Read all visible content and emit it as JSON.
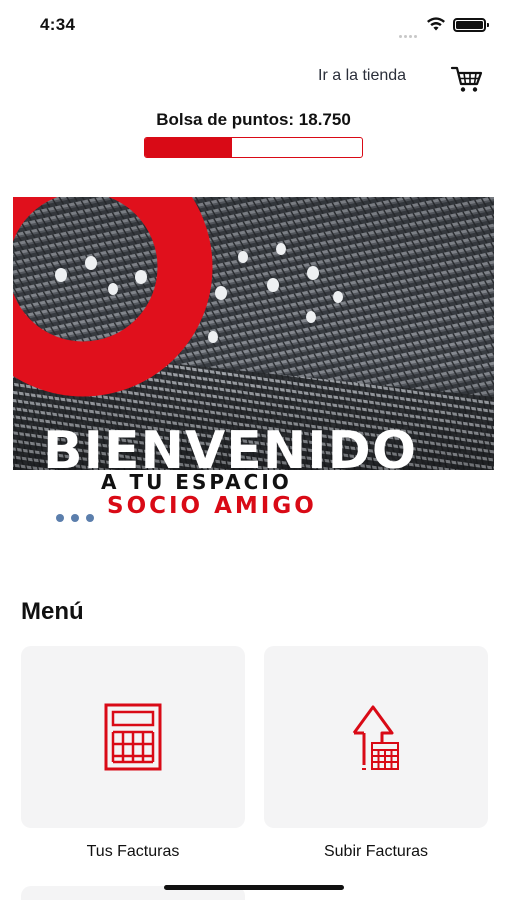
{
  "status_bar": {
    "time": "4:34"
  },
  "header": {
    "store_link": "Ir a la tienda",
    "cart_icon": "shopping-cart-icon"
  },
  "points": {
    "label": "Bolsa de puntos: 18.750",
    "progress": 0.4
  },
  "banner": {
    "title": "BIENVENIDO",
    "subtitle_line1": "A TU ESPACIO",
    "subtitle_line2": "SOCIO AMIGO",
    "page_indicator_count": 3
  },
  "menu": {
    "title": "Menú",
    "items": [
      {
        "label": "Tus Facturas",
        "icon": "calculator-icon"
      },
      {
        "label": "Subir Facturas",
        "icon": "upload-invoice-icon"
      }
    ]
  },
  "colors": {
    "brand_red": "#d90a16",
    "card_bg": "#f4f4f5",
    "dots": "#5b7eac"
  }
}
